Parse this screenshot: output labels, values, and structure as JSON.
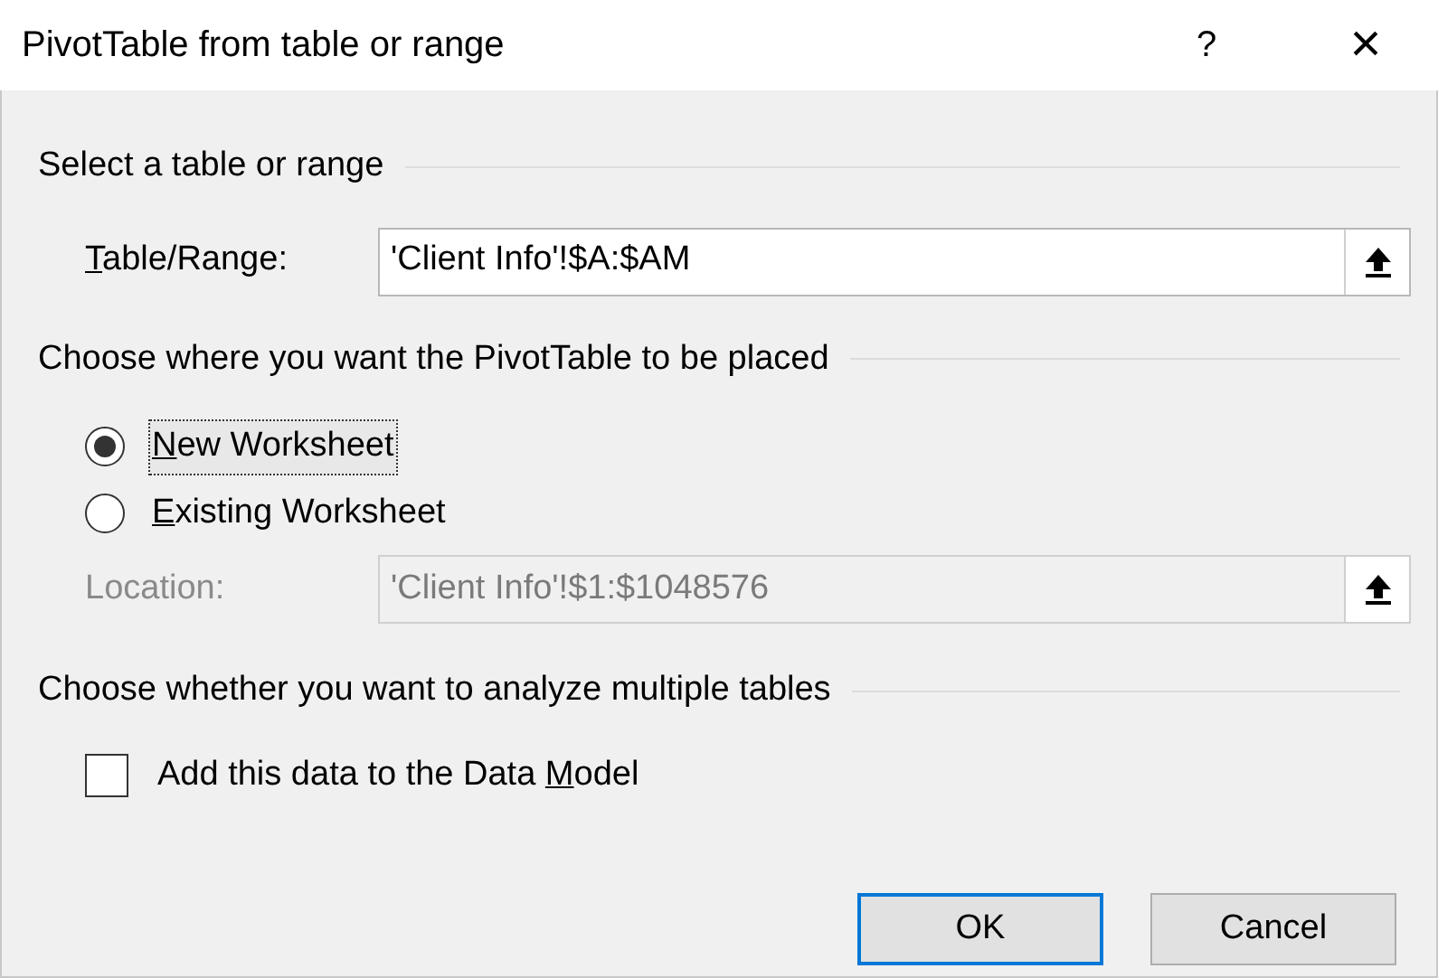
{
  "window": {
    "title": "PivotTable from table or range",
    "help": "?",
    "close": "×"
  },
  "sections": [
    {
      "kind": "range",
      "heading": "Select a table or range",
      "field": {
        "label": {
          "key": "T",
          "after": "able/Range:"
        },
        "value": "'Client Info'!$A:$AM",
        "disabled": false
      }
    },
    {
      "kind": "placement",
      "heading": "Choose where you want the PivotTable to be placed",
      "options": [
        {
          "label": {
            "key": "N",
            "after": "ew Worksheet"
          },
          "selected": true,
          "focused": true
        },
        {
          "label": {
            "key": "E",
            "after": "xisting Worksheet"
          },
          "selected": false,
          "focused": false
        }
      ],
      "field": {
        "label": {
          "before": "Location:"
        },
        "value": "'Client Info'!$1:$1048576",
        "disabled": true
      }
    },
    {
      "kind": "multiple",
      "heading": "Choose whether you want to analyze multiple tables",
      "checkbox": {
        "label": {
          "before": "Add this data to the Data ",
          "key": "M",
          "after": "odel"
        },
        "checked": false
      }
    }
  ],
  "buttons": [
    {
      "label": "OK",
      "default": true
    },
    {
      "label": "Cancel",
      "default": false
    }
  ]
}
